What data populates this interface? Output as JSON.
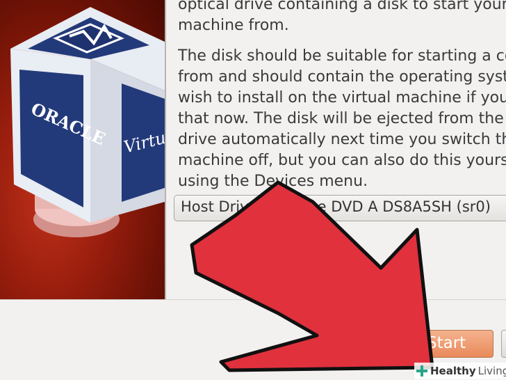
{
  "wizard": {
    "paragraph_1": [
      "optical drive containing a disk to start your n",
      "machine from."
    ],
    "paragraph_2": [
      "The disk should be suitable for starting a com",
      "from and should contain the operating syste",
      "wish to install on the virtual machine if you w",
      "that now. The disk will be ejected from the vi",
      "drive automatically next time you switch the",
      "machine off, but you can also do this yoursel",
      "using the Devices menu."
    ],
    "drive_select_value": "Host Drive Slimtype DVD A  DS8A5SH   (sr0)"
  },
  "banner": {
    "logo_text": "ORACLE",
    "logo_text_2": "Virtu"
  },
  "buttons": {
    "start_label": "Start"
  },
  "watermark": {
    "text_bold": "Healthy",
    "text_normal": "Living"
  },
  "colors": {
    "arrow": "#e0313d",
    "arrow_outline": "#111111",
    "banner_red": "#9a1e0e",
    "start_button": "#e9895a"
  }
}
